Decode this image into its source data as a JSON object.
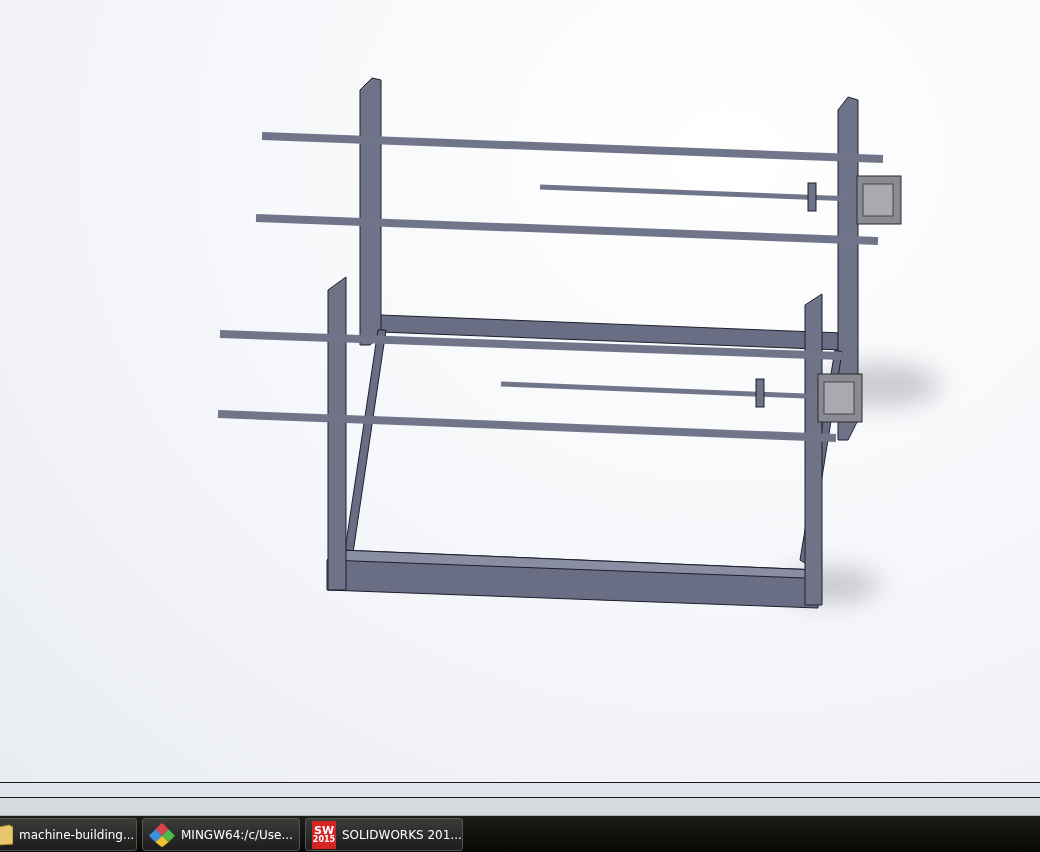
{
  "taskbar": {
    "items": [
      {
        "kind": "folder",
        "label": "machine-building..."
      },
      {
        "kind": "mingw",
        "label": "MINGW64:/c/Use..."
      },
      {
        "kind": "solidworks",
        "label": "SOLIDWORKS 201...",
        "icon_text": "SW",
        "icon_year": "2015"
      }
    ]
  }
}
